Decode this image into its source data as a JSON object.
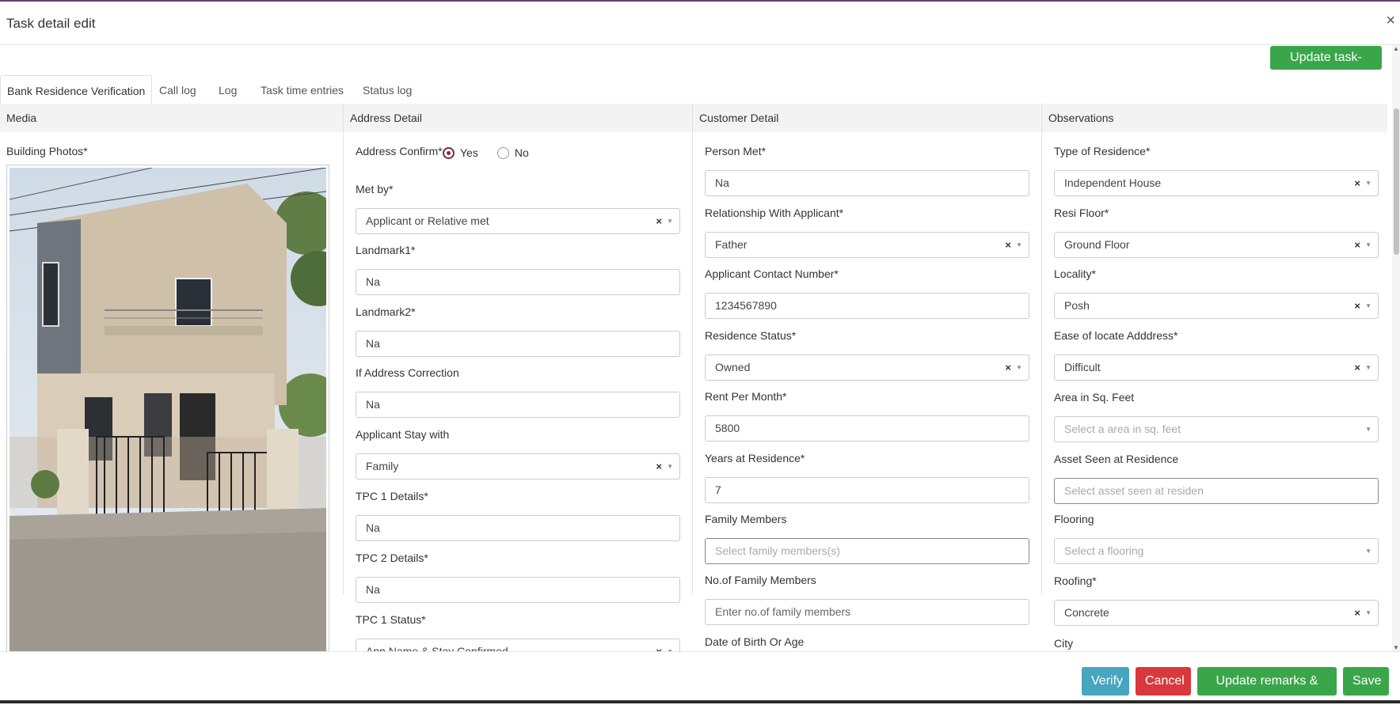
{
  "window": {
    "title": "Task detail edit",
    "close_glyph": "×"
  },
  "toolbar": {
    "update_task_label": "Update task-data"
  },
  "tabs": [
    {
      "label": "Bank Residence Verification",
      "active": true
    },
    {
      "label": "Call log"
    },
    {
      "label": "Log"
    },
    {
      "label": "Task time entries"
    },
    {
      "label": "Status log"
    }
  ],
  "media": {
    "header": "Media",
    "building_photos_label": "Building Photos*"
  },
  "address": {
    "header": "Address Detail",
    "address_confirm_label": "Address Confirm*",
    "yes_label": "Yes",
    "no_label": "No",
    "met_by_label": "Met by*",
    "met_by_value": "Applicant or Relative met",
    "landmark1_label": "Landmark1*",
    "landmark1_value": "Na",
    "landmark2_label": "Landmark2*",
    "landmark2_value": "Na",
    "correction_label": "If Address Correction",
    "correction_value": "Na",
    "stay_with_label": "Applicant Stay with",
    "stay_with_value": "Family",
    "tpc1_label": "TPC 1 Details*",
    "tpc1_value": "Na",
    "tpc2_label": "TPC 2 Details*",
    "tpc2_value": "Na",
    "tpc1_status_label": "TPC 1 Status*",
    "tpc1_status_value": "App Name & Stay Confirmed"
  },
  "customer": {
    "header": "Customer Detail",
    "person_met_label": "Person Met*",
    "person_met_value": "Na",
    "relationship_label": "Relationship With Applicant*",
    "relationship_value": "Father",
    "contact_label": "Applicant Contact Number*",
    "contact_value": "1234567890",
    "residence_status_label": "Residence Status*",
    "residence_status_value": "Owned",
    "rent_label": "Rent Per Month*",
    "rent_value": "5800",
    "years_label": "Years at Residence*",
    "years_value": "7",
    "family_members_label": "Family Members",
    "family_members_placeholder": "Select family members(s)",
    "no_family_label": "No.of Family Members",
    "no_family_placeholder": "Enter no.of family members",
    "dob_label": "Date of Birth Or Age"
  },
  "observations": {
    "header": "Observations",
    "type_label": "Type of Residence*",
    "type_value": "Independent House",
    "floor_label": "Resi Floor*",
    "floor_value": "Ground Floor",
    "locality_label": "Locality*",
    "locality_value": "Posh",
    "ease_label": "Ease of locate Adddress*",
    "ease_value": "Difficult",
    "area_label": "Area in Sq. Feet",
    "area_placeholder": "Select a area in sq. feet",
    "asset_label": "Asset Seen at Residence",
    "asset_placeholder": "Select asset seen at residen",
    "flooring_label": "Flooring",
    "flooring_placeholder": "Select a flooring",
    "roofing_label": "Roofing*",
    "roofing_value": "Concrete",
    "city_label": "City"
  },
  "footer": {
    "verify_label": "Verify",
    "cancel_label": "Cancel",
    "update_remarks_label": "Update remarks & data",
    "save_label": "Save"
  },
  "colors": {
    "accent_green": "#3aa64a",
    "danger_red": "#d9383d",
    "info_teal": "#46a5bf",
    "radio_selected": "#7b2d3e"
  },
  "icons": {
    "clear": "clear-selection-icon",
    "caret": "chevron-down-icon",
    "close": "close-icon"
  }
}
